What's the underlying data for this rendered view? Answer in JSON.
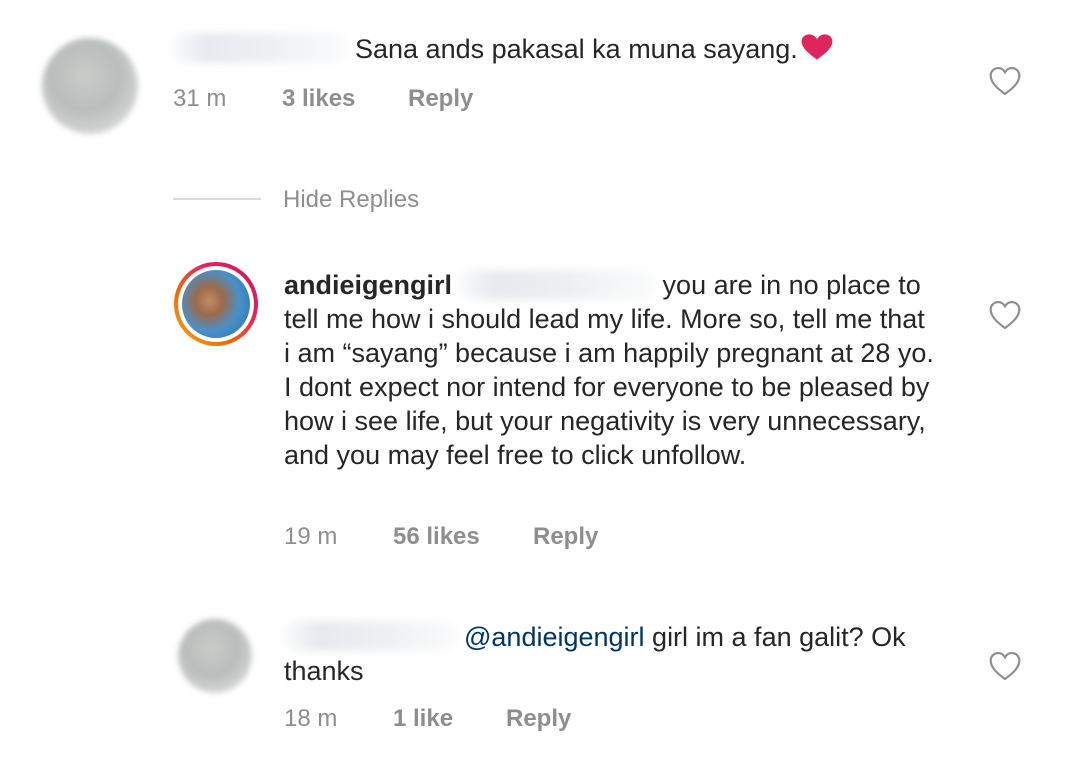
{
  "comment1": {
    "text": "Sana ands pakasal ka muna sayang.",
    "emoji": "heart-emoji",
    "time": "31 m",
    "likes": "3 likes",
    "reply_label": "Reply"
  },
  "hide_replies_label": "Hide Replies",
  "reply1": {
    "username": "andieigengirl",
    "text_line1": "you are in no place to",
    "text_rest": "tell me how i should lead my life. More so, tell me that i am “sayang” because i am happily pregnant at 28 yo. I dont expect nor intend for everyone to be pleased by how i see life, but your negativity is very unnecessary, and you may feel free to click unfollow.",
    "time": "19 m",
    "likes": "56 likes",
    "reply_label": "Reply"
  },
  "reply2": {
    "mention": "@andieigengirl",
    "text_line1": "girl im a fan galit? Ok",
    "text_line2": "thanks",
    "time": "18 m",
    "likes": "1 like",
    "reply_label": "Reply"
  },
  "colors": {
    "text": "#262626",
    "meta": "#8e8e8e",
    "mention": "#003569",
    "heart_emoji": "#e0245e"
  }
}
